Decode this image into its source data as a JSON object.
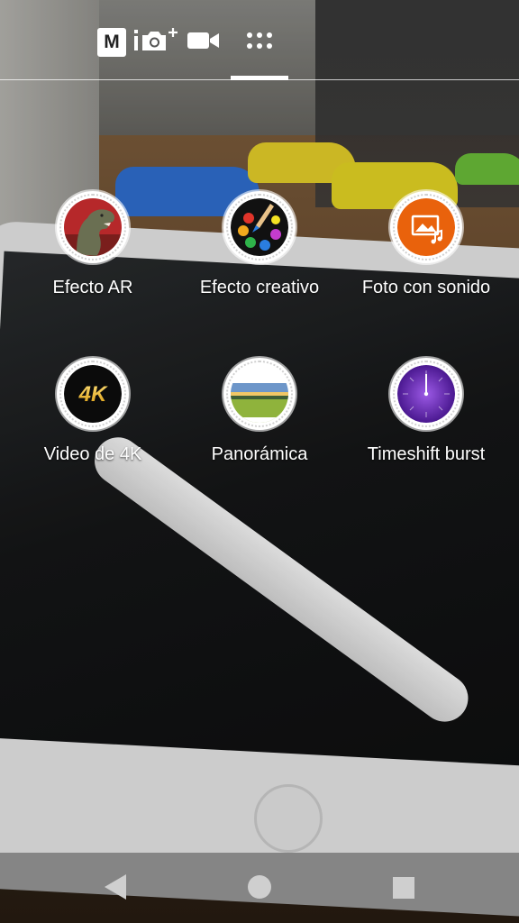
{
  "topbar": {
    "manual_icon_text": "M",
    "tabs": [
      {
        "icon": "manual-mode-icon"
      },
      {
        "icon": "smart-photo-icon"
      },
      {
        "icon": "video-camera-icon"
      },
      {
        "icon": "grid-apps-icon",
        "active": true
      }
    ]
  },
  "modes": [
    {
      "label": "Efecto AR",
      "icon": "dinosaur-icon"
    },
    {
      "label": "Efecto creativo",
      "icon": "paint-palette-icon"
    },
    {
      "label": "Foto con sonido",
      "icon": "sound-photo-icon"
    },
    {
      "label": "Video de 4K",
      "icon": "4k-icon",
      "icon_text": "4K"
    },
    {
      "label": "Panorámica",
      "icon": "panorama-icon"
    },
    {
      "label": "Timeshift burst",
      "icon": "timeshift-icon"
    }
  ],
  "colors": {
    "accent_orange": "#e9620c",
    "timeshift_purple": "#6a2bb8",
    "palette_dots": [
      "#e0342a",
      "#f2a91d",
      "#2fb34a",
      "#2a7de0",
      "#c43ccf",
      "#f4e323"
    ]
  },
  "navbar": {
    "buttons": [
      "back-icon",
      "home-icon",
      "recents-icon"
    ]
  }
}
